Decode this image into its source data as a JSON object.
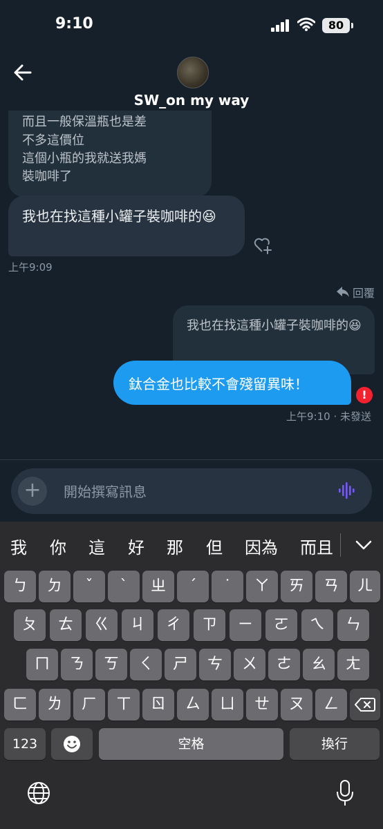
{
  "status_bar": {
    "time": "9:10",
    "battery": "80"
  },
  "header": {
    "contact_name": "SW_on my way"
  },
  "messages": {
    "old_received_lines": [
      "而且一般保溫瓶也是差",
      "不多這價位",
      "這個小瓶的我就送我媽",
      "裝咖啡了"
    ],
    "received_text": "我也在找這種小罐子裝咖啡的😆",
    "received_time": "上午9:09",
    "reply_label": "回覆",
    "quoted_text": "我也在找這種小罐子裝咖啡的😆",
    "sent_text": "鈦合金也比較不會殘留異味！",
    "sent_status": "上午9:10 · 未發送"
  },
  "composer": {
    "placeholder": "開始撰寫訊息"
  },
  "keyboard": {
    "suggestions": [
      "我",
      "你",
      "這",
      "好",
      "那",
      "但",
      "因為",
      "而且"
    ],
    "rows": [
      [
        "ㄅ",
        "ㄉ",
        "ˇ",
        "ˋ",
        "ㄓ",
        "ˊ",
        "˙",
        "ㄚ",
        "ㄞ",
        "ㄢ",
        "ㄦ"
      ],
      [
        "ㄆ",
        "ㄊ",
        "ㄍ",
        "ㄐ",
        "ㄔ",
        "ㄗ",
        "ㄧ",
        "ㄛ",
        "ㄟ",
        "ㄣ"
      ],
      [
        "ㄇ",
        "ㄋ",
        "ㄎ",
        "ㄑ",
        "ㄕ",
        "ㄘ",
        "ㄨ",
        "ㄜ",
        "ㄠ",
        "ㄤ"
      ],
      [
        "ㄈ",
        "ㄌ",
        "ㄏ",
        "ㄒ",
        "ㄖ",
        "ㄙ",
        "ㄩ",
        "ㄝ",
        "ㄡ",
        "ㄥ"
      ]
    ],
    "numbers_key": "123",
    "space_key": "空格",
    "return_key": "換行"
  },
  "colors": {
    "accent": "#1d9bf0",
    "error": "#f4212e",
    "background": "#15202b"
  }
}
